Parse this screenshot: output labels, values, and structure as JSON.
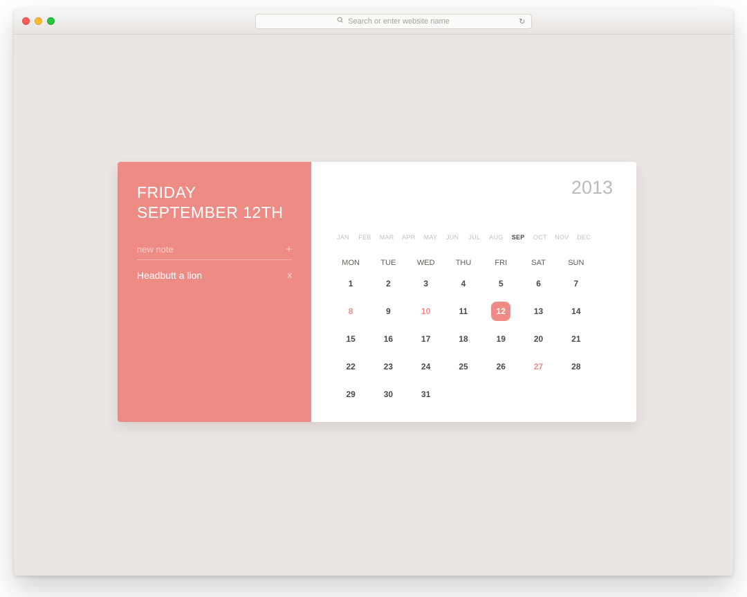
{
  "browser": {
    "address_placeholder": "Search or enter website name"
  },
  "sidebar": {
    "day_name": "FRIDAY",
    "date_line": "SEPTEMBER 12TH",
    "new_note_placeholder": "new note",
    "add_icon_label": "+",
    "notes": [
      {
        "text": "Headbutt a lion",
        "remove_label": "x"
      }
    ]
  },
  "calendar": {
    "year": "2013",
    "months": [
      "JAN",
      "FEB",
      "MAR",
      "APR",
      "MAY",
      "JUN",
      "JUL",
      "AUG",
      "SEP",
      "OCT",
      "NOV",
      "DEC"
    ],
    "active_month_index": 8,
    "dows": [
      "MON",
      "TUE",
      "WED",
      "THU",
      "FRI",
      "SAT",
      "SUN"
    ],
    "dates": [
      {
        "d": "1"
      },
      {
        "d": "2"
      },
      {
        "d": "3"
      },
      {
        "d": "4"
      },
      {
        "d": "5"
      },
      {
        "d": "6"
      },
      {
        "d": "7"
      },
      {
        "d": "8",
        "highlight": true
      },
      {
        "d": "9"
      },
      {
        "d": "10",
        "highlight": true
      },
      {
        "d": "11"
      },
      {
        "d": "12",
        "selected": true
      },
      {
        "d": "13"
      },
      {
        "d": "14"
      },
      {
        "d": "15"
      },
      {
        "d": "16"
      },
      {
        "d": "17"
      },
      {
        "d": "18"
      },
      {
        "d": "19"
      },
      {
        "d": "20"
      },
      {
        "d": "21"
      },
      {
        "d": "22"
      },
      {
        "d": "23"
      },
      {
        "d": "24"
      },
      {
        "d": "25"
      },
      {
        "d": "26"
      },
      {
        "d": "27",
        "highlight": true
      },
      {
        "d": "28"
      },
      {
        "d": "29"
      },
      {
        "d": "30"
      },
      {
        "d": "31"
      }
    ]
  }
}
